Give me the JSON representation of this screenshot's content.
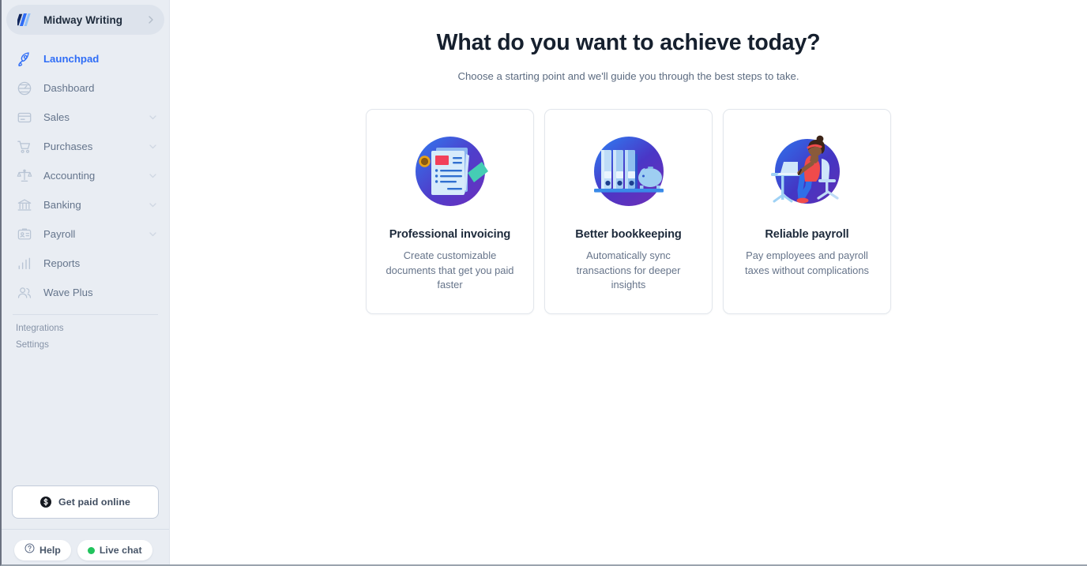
{
  "sidebar": {
    "workspace": {
      "name": "Midway Writing",
      "logo_icon": "wave-logo-icon",
      "caret_icon": "chevron-right-icon"
    },
    "nav_items": [
      {
        "label": "Launchpad",
        "icon": "rocket-icon",
        "active": true,
        "expandable": false
      },
      {
        "label": "Dashboard",
        "icon": "dashboard-icon",
        "active": false,
        "expandable": false
      },
      {
        "label": "Sales",
        "icon": "credit-card-icon",
        "active": false,
        "expandable": true
      },
      {
        "label": "Purchases",
        "icon": "shopping-cart-icon",
        "active": false,
        "expandable": true
      },
      {
        "label": "Accounting",
        "icon": "scales-icon",
        "active": false,
        "expandable": true
      },
      {
        "label": "Banking",
        "icon": "bank-icon",
        "active": false,
        "expandable": true
      },
      {
        "label": "Payroll",
        "icon": "id-badge-icon",
        "active": false,
        "expandable": true
      },
      {
        "label": "Reports",
        "icon": "bar-chart-icon",
        "active": false,
        "expandable": false
      },
      {
        "label": "Wave Plus",
        "icon": "people-icon",
        "active": false,
        "expandable": false
      }
    ],
    "sub_links": [
      {
        "label": "Integrations"
      },
      {
        "label": "Settings"
      }
    ],
    "get_paid": {
      "label": "Get paid online",
      "icon": "dollar-coin-icon"
    },
    "help_pill": {
      "label": "Help",
      "icon": "question-circle-icon"
    },
    "live_chat_pill": {
      "label": "Live chat",
      "icon": "status-dot-icon",
      "status_color": "#21c35c"
    }
  },
  "main": {
    "title": "What do you want to achieve today?",
    "subtitle": "Choose a starting point and we'll guide you through the best steps to take.",
    "cards": [
      {
        "title": "Professional invoicing",
        "description": "Create customizable documents that get you paid faster",
        "illustration": "invoice-document-illustration"
      },
      {
        "title": "Better bookkeeping",
        "description": "Automatically sync transactions for deeper insights",
        "illustration": "binders-piggybank-illustration"
      },
      {
        "title": "Reliable payroll",
        "description": "Pay employees and payroll taxes without complications",
        "illustration": "person-at-desk-illustration"
      }
    ]
  },
  "colors": {
    "accent": "#2f6df6",
    "sidebar_bg": "#e9edf3",
    "card_border": "#e2e6ec",
    "title": "#16202e",
    "online_status": "#21c35c"
  }
}
